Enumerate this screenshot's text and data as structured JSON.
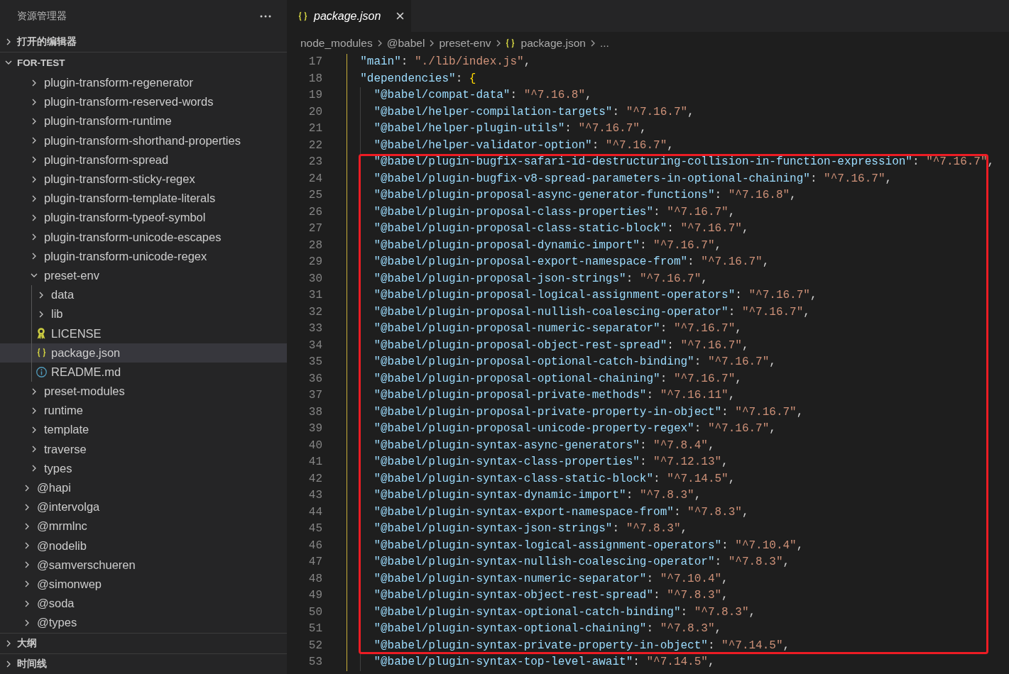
{
  "sidebar": {
    "title": "资源管理器",
    "sections": [
      {
        "title": "打开的编辑器",
        "expanded": false
      },
      {
        "title": "FOR-TEST",
        "expanded": true,
        "children": [
          {
            "children": [
              {
                "children": [
                  {
                    "label": "plugin-transform-regenerator",
                    "kind": "folder",
                    "expanded": false,
                    "selected": false
                  },
                  {
                    "label": "plugin-transform-reserved-words",
                    "kind": "folder",
                    "expanded": false,
                    "selected": false
                  },
                  {
                    "label": "plugin-transform-runtime",
                    "kind": "folder",
                    "expanded": false,
                    "selected": false
                  },
                  {
                    "label": "plugin-transform-shorthand-properties",
                    "kind": "folder",
                    "expanded": false,
                    "selected": false
                  },
                  {
                    "label": "plugin-transform-spread",
                    "kind": "folder",
                    "expanded": false,
                    "selected": false
                  },
                  {
                    "label": "plugin-transform-sticky-regex",
                    "kind": "folder",
                    "expanded": false,
                    "selected": false
                  },
                  {
                    "label": "plugin-transform-template-literals",
                    "kind": "folder",
                    "expanded": false,
                    "selected": false
                  },
                  {
                    "label": "plugin-transform-typeof-symbol",
                    "kind": "folder",
                    "expanded": false,
                    "selected": false
                  },
                  {
                    "label": "plugin-transform-unicode-escapes",
                    "kind": "folder",
                    "expanded": false,
                    "selected": false
                  },
                  {
                    "label": "plugin-transform-unicode-regex",
                    "kind": "folder",
                    "expanded": false,
                    "selected": false
                  },
                  {
                    "label": "preset-env",
                    "kind": "folder",
                    "expanded": true,
                    "selected": false,
                    "children": [
                      {
                        "label": "data",
                        "kind": "folder",
                        "expanded": false,
                        "selected": false
                      },
                      {
                        "label": "lib",
                        "kind": "folder",
                        "expanded": false,
                        "selected": false
                      },
                      {
                        "label": "LICENSE",
                        "kind": "license",
                        "selected": false
                      },
                      {
                        "label": "package.json",
                        "kind": "json",
                        "selected": true
                      },
                      {
                        "label": "README.md",
                        "kind": "markdown",
                        "selected": false
                      }
                    ]
                  },
                  {
                    "label": "preset-modules",
                    "kind": "folder",
                    "expanded": false,
                    "selected": false
                  },
                  {
                    "label": "runtime",
                    "kind": "folder",
                    "expanded": false,
                    "selected": false
                  },
                  {
                    "label": "template",
                    "kind": "folder",
                    "expanded": false,
                    "selected": false
                  },
                  {
                    "label": "traverse",
                    "kind": "folder",
                    "expanded": false,
                    "selected": false
                  },
                  {
                    "label": "types",
                    "kind": "folder",
                    "expanded": false,
                    "selected": false
                  }
                ]
              },
              {
                "label": "@hapi",
                "kind": "folder",
                "expanded": false,
                "selected": false
              },
              {
                "label": "@intervolga",
                "kind": "folder",
                "expanded": false,
                "selected": false
              },
              {
                "label": "@mrmlnc",
                "kind": "folder",
                "expanded": false,
                "selected": false
              },
              {
                "label": "@nodelib",
                "kind": "folder",
                "expanded": false,
                "selected": false
              },
              {
                "label": "@samverschueren",
                "kind": "folder",
                "expanded": false,
                "selected": false
              },
              {
                "label": "@simonwep",
                "kind": "folder",
                "expanded": false,
                "selected": false
              },
              {
                "label": "@soda",
                "kind": "folder",
                "expanded": false,
                "selected": false
              },
              {
                "label": "@types",
                "kind": "folder",
                "expanded": false,
                "selected": false
              }
            ]
          }
        ]
      },
      {
        "title": "大纲",
        "expanded": false
      },
      {
        "title": "时间线",
        "expanded": false
      }
    ]
  },
  "editor": {
    "tabs": [
      {
        "label": "package.json",
        "kind": "json",
        "selected": true,
        "preview": true
      }
    ],
    "breadcrumbs": [
      {
        "label": "node_modules",
        "kind": "folder"
      },
      {
        "label": "@babel",
        "kind": "folder"
      },
      {
        "label": "preset-env",
        "kind": "folder"
      },
      {
        "label": "package.json",
        "kind": "json"
      },
      {
        "label": "...",
        "kind": "more"
      }
    ],
    "lines": [
      {
        "children": [
          {
            "number": "17",
            "key": "\"main\"",
            "colon": ": ",
            "value": "\"./lib/index.js\"",
            "comma": ","
          },
          {
            "number": "18",
            "key": "\"dependencies\"",
            "colon": ": ",
            "bracket": "{",
            "children": [
              {
                "kind": "line",
                "number": "19",
                "key": "\"@babel/compat-data\"",
                "colon": ": ",
                "value": "\"^7.16.8\"",
                "comma": ","
              },
              {
                "kind": "line",
                "number": "20",
                "key": "\"@babel/helper-compilation-targets\"",
                "colon": ": ",
                "value": "\"^7.16.7\"",
                "comma": ","
              },
              {
                "kind": "line",
                "number": "21",
                "key": "\"@babel/helper-plugin-utils\"",
                "colon": ": ",
                "value": "\"^7.16.7\"",
                "comma": ","
              },
              {
                "kind": "line",
                "number": "22",
                "key": "\"@babel/helper-validator-option\"",
                "colon": ": ",
                "value": "\"^7.16.7\"",
                "comma": ","
              },
              {
                "kind": "highlight",
                "children": [
                  {
                    "number": "23",
                    "key": "\"@babel/plugin-bugfix-safari-id-destructuring-collision-in-function-expression\"",
                    "colon": ": ",
                    "value": "\"^7.16.7\"",
                    "comma": ","
                  },
                  {
                    "number": "24",
                    "key": "\"@babel/plugin-bugfix-v8-spread-parameters-in-optional-chaining\"",
                    "colon": ": ",
                    "value": "\"^7.16.7\"",
                    "comma": ","
                  },
                  {
                    "number": "25",
                    "key": "\"@babel/plugin-proposal-async-generator-functions\"",
                    "colon": ": ",
                    "value": "\"^7.16.8\"",
                    "comma": ","
                  },
                  {
                    "number": "26",
                    "key": "\"@babel/plugin-proposal-class-properties\"",
                    "colon": ": ",
                    "value": "\"^7.16.7\"",
                    "comma": ","
                  },
                  {
                    "number": "27",
                    "key": "\"@babel/plugin-proposal-class-static-block\"",
                    "colon": ": ",
                    "value": "\"^7.16.7\"",
                    "comma": ","
                  },
                  {
                    "number": "28",
                    "key": "\"@babel/plugin-proposal-dynamic-import\"",
                    "colon": ": ",
                    "value": "\"^7.16.7\"",
                    "comma": ","
                  },
                  {
                    "number": "29",
                    "key": "\"@babel/plugin-proposal-export-namespace-from\"",
                    "colon": ": ",
                    "value": "\"^7.16.7\"",
                    "comma": ","
                  },
                  {
                    "number": "30",
                    "key": "\"@babel/plugin-proposal-json-strings\"",
                    "colon": ": ",
                    "value": "\"^7.16.7\"",
                    "comma": ","
                  },
                  {
                    "number": "31",
                    "key": "\"@babel/plugin-proposal-logical-assignment-operators\"",
                    "colon": ": ",
                    "value": "\"^7.16.7\"",
                    "comma": ","
                  },
                  {
                    "number": "32",
                    "key": "\"@babel/plugin-proposal-nullish-coalescing-operator\"",
                    "colon": ": ",
                    "value": "\"^7.16.7\"",
                    "comma": ","
                  },
                  {
                    "number": "33",
                    "key": "\"@babel/plugin-proposal-numeric-separator\"",
                    "colon": ": ",
                    "value": "\"^7.16.7\"",
                    "comma": ","
                  },
                  {
                    "number": "34",
                    "key": "\"@babel/plugin-proposal-object-rest-spread\"",
                    "colon": ": ",
                    "value": "\"^7.16.7\"",
                    "comma": ","
                  },
                  {
                    "number": "35",
                    "key": "\"@babel/plugin-proposal-optional-catch-binding\"",
                    "colon": ": ",
                    "value": "\"^7.16.7\"",
                    "comma": ","
                  },
                  {
                    "number": "36",
                    "key": "\"@babel/plugin-proposal-optional-chaining\"",
                    "colon": ": ",
                    "value": "\"^7.16.7\"",
                    "comma": ","
                  },
                  {
                    "number": "37",
                    "key": "\"@babel/plugin-proposal-private-methods\"",
                    "colon": ": ",
                    "value": "\"^7.16.11\"",
                    "comma": ","
                  },
                  {
                    "number": "38",
                    "key": "\"@babel/plugin-proposal-private-property-in-object\"",
                    "colon": ": ",
                    "value": "\"^7.16.7\"",
                    "comma": ","
                  },
                  {
                    "number": "39",
                    "key": "\"@babel/plugin-proposal-unicode-property-regex\"",
                    "colon": ": ",
                    "value": "\"^7.16.7\"",
                    "comma": ","
                  },
                  {
                    "number": "40",
                    "key": "\"@babel/plugin-syntax-async-generators\"",
                    "colon": ": ",
                    "value": "\"^7.8.4\"",
                    "comma": ","
                  },
                  {
                    "number": "41",
                    "key": "\"@babel/plugin-syntax-class-properties\"",
                    "colon": ": ",
                    "value": "\"^7.12.13\"",
                    "comma": ","
                  },
                  {
                    "number": "42",
                    "key": "\"@babel/plugin-syntax-class-static-block\"",
                    "colon": ": ",
                    "value": "\"^7.14.5\"",
                    "comma": ","
                  },
                  {
                    "number": "43",
                    "key": "\"@babel/plugin-syntax-dynamic-import\"",
                    "colon": ": ",
                    "value": "\"^7.8.3\"",
                    "comma": ","
                  },
                  {
                    "number": "44",
                    "key": "\"@babel/plugin-syntax-export-namespace-from\"",
                    "colon": ": ",
                    "value": "\"^7.8.3\"",
                    "comma": ","
                  },
                  {
                    "number": "45",
                    "key": "\"@babel/plugin-syntax-json-strings\"",
                    "colon": ": ",
                    "value": "\"^7.8.3\"",
                    "comma": ","
                  },
                  {
                    "number": "46",
                    "key": "\"@babel/plugin-syntax-logical-assignment-operators\"",
                    "colon": ": ",
                    "value": "\"^7.10.4\"",
                    "comma": ","
                  },
                  {
                    "number": "47",
                    "key": "\"@babel/plugin-syntax-nullish-coalescing-operator\"",
                    "colon": ": ",
                    "value": "\"^7.8.3\"",
                    "comma": ","
                  },
                  {
                    "number": "48",
                    "key": "\"@babel/plugin-syntax-numeric-separator\"",
                    "colon": ": ",
                    "value": "\"^7.10.4\"",
                    "comma": ","
                  },
                  {
                    "number": "49",
                    "key": "\"@babel/plugin-syntax-object-rest-spread\"",
                    "colon": ": ",
                    "value": "\"^7.8.3\"",
                    "comma": ","
                  },
                  {
                    "number": "50",
                    "key": "\"@babel/plugin-syntax-optional-catch-binding\"",
                    "colon": ": ",
                    "value": "\"^7.8.3\"",
                    "comma": ","
                  },
                  {
                    "number": "51",
                    "key": "\"@babel/plugin-syntax-optional-chaining\"",
                    "colon": ": ",
                    "value": "\"^7.8.3\"",
                    "comma": ","
                  },
                  {
                    "number": "52",
                    "key": "\"@babel/plugin-syntax-private-property-in-object\"",
                    "colon": ": ",
                    "value": "\"^7.14.5\"",
                    "comma": ","
                  }
                ]
              },
              {
                "kind": "line",
                "number": "53",
                "key": "\"@babel/plugin-syntax-top-level-await\"",
                "colon": ": ",
                "value": "\"^7.14.5\"",
                "comma": ","
              }
            ]
          }
        ]
      }
    ]
  }
}
